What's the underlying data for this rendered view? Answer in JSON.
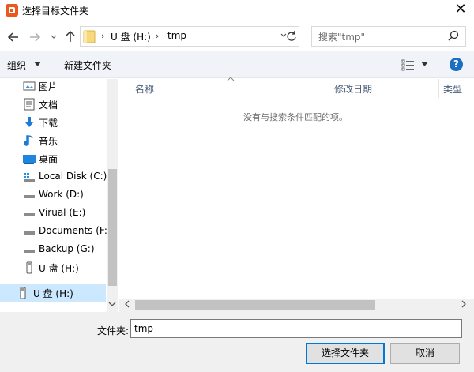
{
  "window": {
    "title": "选择目标文件夹",
    "close_glyph": "✕"
  },
  "address": {
    "breadcrumbs": [
      "U 盘 (H:)",
      "tmp"
    ],
    "separator": "›",
    "search_placeholder": "搜索\"tmp\""
  },
  "toolbar": {
    "organize_label": "组织",
    "new_folder_label": "新建文件夹",
    "help_glyph": "?"
  },
  "sidebar": {
    "items": [
      {
        "label": "图片",
        "icon": "pictures-icon"
      },
      {
        "label": "文档",
        "icon": "documents-icon"
      },
      {
        "label": "下载",
        "icon": "download-icon"
      },
      {
        "label": "音乐",
        "icon": "music-icon"
      },
      {
        "label": "桌面",
        "icon": "desktop-icon"
      },
      {
        "label": "Local Disk (C:)",
        "icon": "system-drive-icon"
      },
      {
        "label": "Work (D:)",
        "icon": "drive-icon"
      },
      {
        "label": "Virual (E:)",
        "icon": "drive-icon"
      },
      {
        "label": "Documents (F:)",
        "icon": "drive-icon"
      },
      {
        "label": "Backup (G:)",
        "icon": "drive-icon"
      },
      {
        "label": "U 盘 (H:)",
        "icon": "usb-drive-icon"
      }
    ],
    "selected": {
      "label": "U 盘 (H:)",
      "icon": "usb-drive-icon"
    }
  },
  "main": {
    "columns": [
      "名称",
      "修改日期",
      "类型"
    ],
    "empty_message": "没有与搜索条件匹配的项。"
  },
  "footer": {
    "folder_label": "文件夹:",
    "folder_value": "tmp",
    "select_button": "选择文件夹",
    "cancel_button": "取消"
  },
  "colors": {
    "accent": "#0078d7",
    "selection": "#cce8ff",
    "toolbar": "#f0f4f9",
    "help": "#1b6ec2"
  }
}
